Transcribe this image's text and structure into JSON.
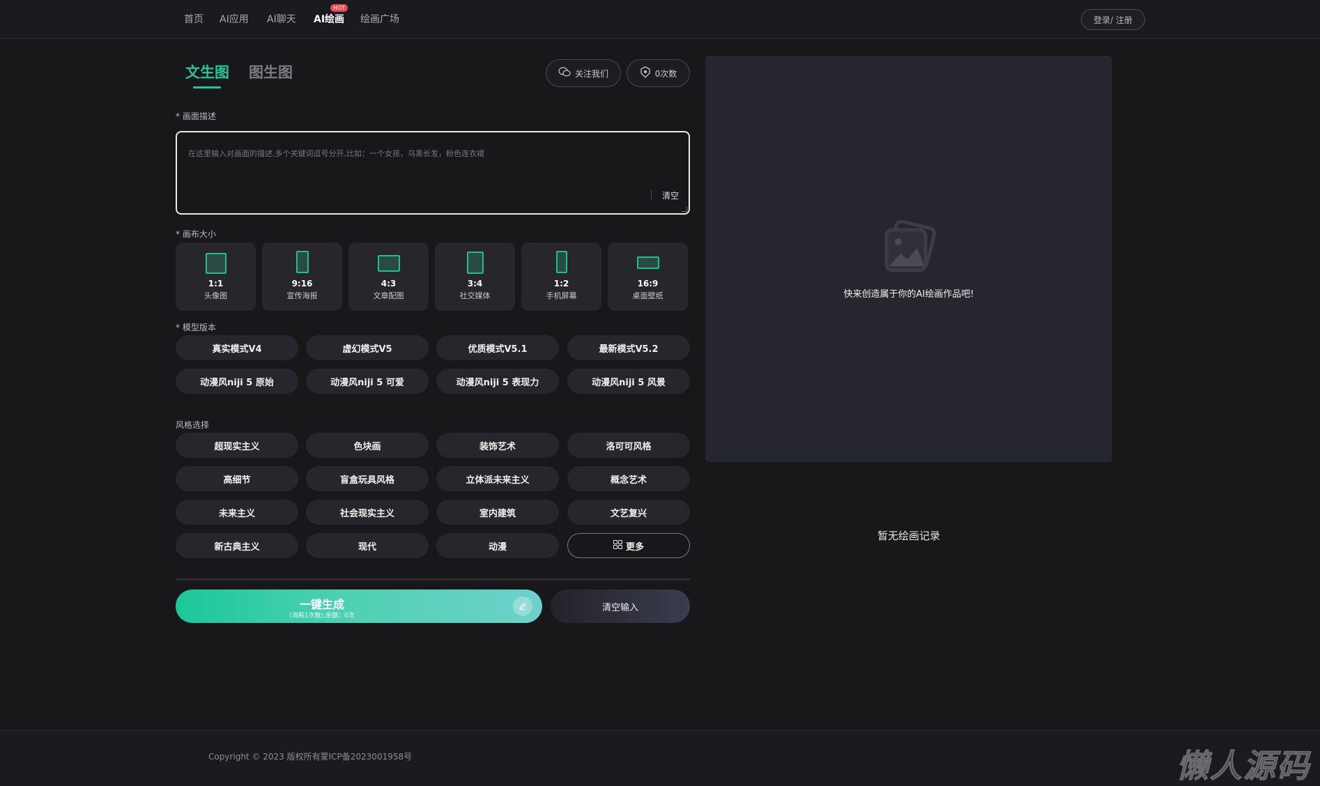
{
  "nav": {
    "items": [
      "首页",
      "AI应用",
      "AI聊天",
      "AI绘画",
      "绘画广场"
    ],
    "hot_badge": "HOT",
    "login": "登录/ 注册"
  },
  "tabs": [
    "文生图",
    "图生图"
  ],
  "follow_button": "关注我们",
  "count_button": "0次数",
  "prompt": {
    "label": "* 画面描述",
    "placeholder": "在这里输入对画面的描述,多个关键词逗号分开,比如：一个女孩，乌黑长发，粉色连衣裙",
    "clear": "清空"
  },
  "canvas": {
    "label": "* 画布大小",
    "sizes": [
      {
        "ratio": "1:1",
        "name": "头像图"
      },
      {
        "ratio": "9:16",
        "name": "宣传海报"
      },
      {
        "ratio": "4:3",
        "name": "文章配图"
      },
      {
        "ratio": "3:4",
        "name": "社交媒体"
      },
      {
        "ratio": "1:2",
        "name": "手机屏幕"
      },
      {
        "ratio": "16:9",
        "name": "桌面壁纸"
      }
    ]
  },
  "model": {
    "label": "* 模型版本",
    "options": [
      "真实模式V4",
      "虚幻模式V5",
      "优质模式V5.1",
      "最新模式V5.2",
      "动漫风niji 5 原始",
      "动漫风niji 5 可爱",
      "动漫风niji 5 表现力",
      "动漫风niji 5 风景"
    ]
  },
  "style": {
    "label": "风格选择",
    "options": [
      "超现实主义",
      "色块画",
      "装饰艺术",
      "洛可可风格",
      "高细节",
      "盲盒玩具风格",
      "立体派未来主义",
      "概念艺术",
      "未来主义",
      "社会现实主义",
      "室内建筑",
      "文艺复兴",
      "新古典主义",
      "现代",
      "动漫"
    ],
    "more": "更多"
  },
  "generate": {
    "title": "一键生成",
    "subtitle": "(消耗1次数),余额：0次"
  },
  "clear_input": "清空输入",
  "preview": {
    "empty_text": "快来创造属于你的AI绘画作品吧!"
  },
  "no_record": "暂无绘画记录",
  "footer": {
    "copyright": "Copyright © 2023 版权所有蒙ICP备2023001958号"
  },
  "watermark": "懒人源码",
  "colors": {
    "accent": "#21c79a",
    "background": "#18181b",
    "card": "#26262c",
    "hot": "#e8474f"
  }
}
